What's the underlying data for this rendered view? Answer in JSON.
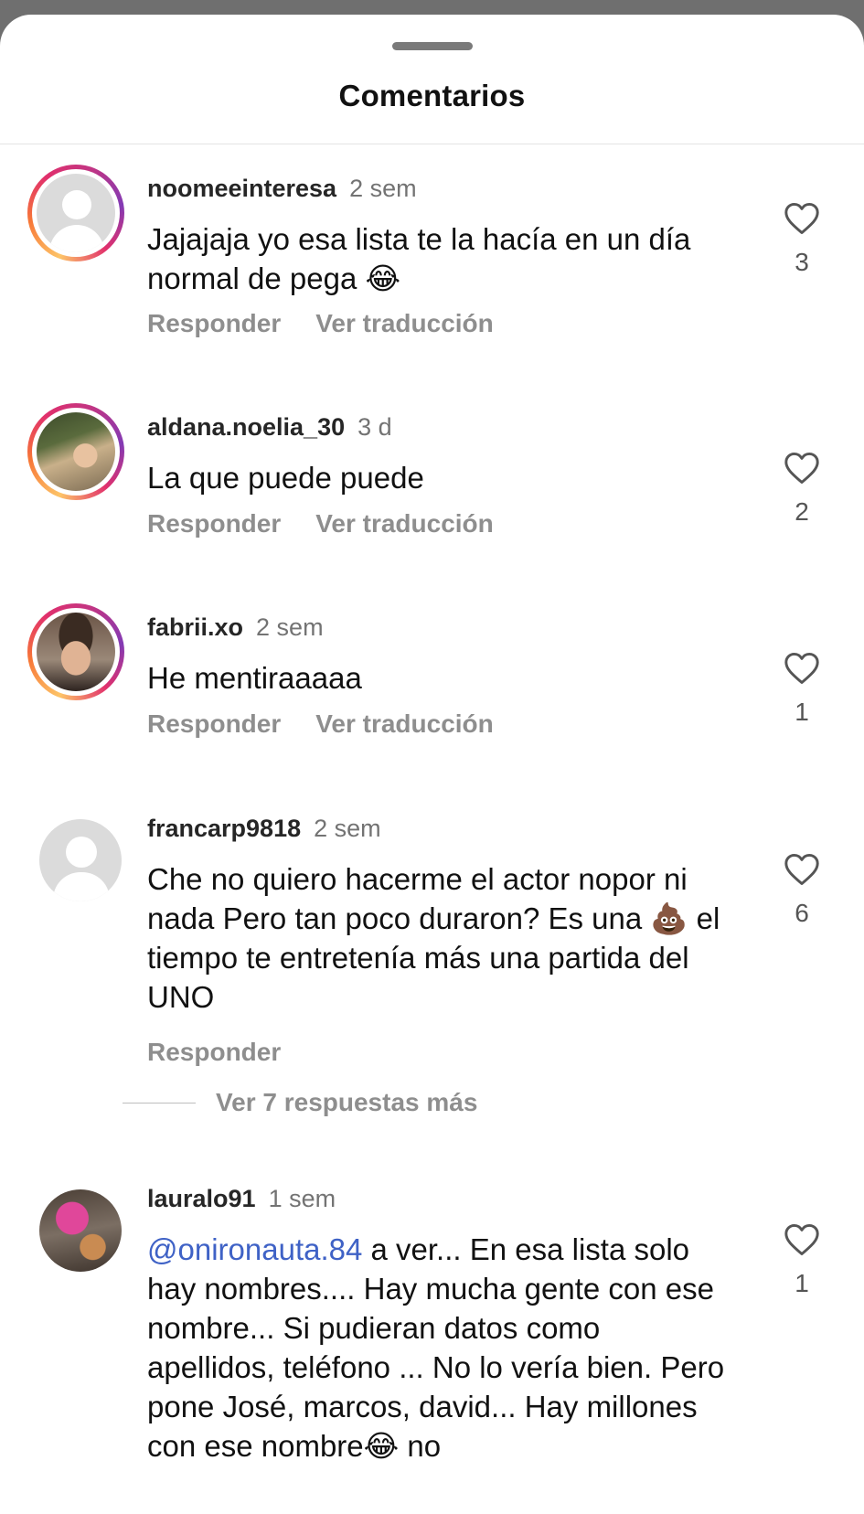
{
  "header": {
    "title": "Comentarios"
  },
  "comments": [
    {
      "username": "noomeeinteresa",
      "time": "2 sem",
      "text": "Jajajaja yo esa lista te la hacía en un día normal de pega 😂",
      "reply_label": "Responder",
      "translate_label": "Ver traducción",
      "likes": "3",
      "avatar": "default-avatar",
      "story_ring": true
    },
    {
      "username": "aldana.noelia_30",
      "time": "3 d",
      "text": "La que puede puede",
      "reply_label": "Responder",
      "translate_label": "Ver traducción",
      "likes": "2",
      "avatar": "photo-avatar",
      "story_ring": true
    },
    {
      "username": "fabrii.xo",
      "time": "2 sem",
      "text": "He mentiraaaaa",
      "reply_label": "Responder",
      "translate_label": "Ver traducción",
      "likes": "1",
      "avatar": "photo-avatar",
      "story_ring": true
    },
    {
      "username": "francarp9818",
      "time": "2 sem",
      "text": "Che no quiero hacerme el actor nopor ni nada Pero tan poco duraron? Es una 💩 el tiempo te entretenía más una partida del UNO",
      "reply_label": "Responder",
      "likes": "6",
      "avatar": "default-avatar",
      "story_ring": false
    },
    {
      "username": "lauralo91",
      "time": "1 sem",
      "mention": "@onironauta.84",
      "text": " a ver... En esa lista solo hay nombres.... Hay mucha gente con ese nombre... Si pudieran datos como apellidos, teléfono ... No lo vería bien. Pero pone José, marcos, david... Hay millones con ese nombre😂 no",
      "likes": "1",
      "avatar": "photo-avatar",
      "story_ring": false
    }
  ],
  "more_replies": "Ver 7 respuestas más",
  "icons": {
    "like": "heart-outline-icon",
    "default_avatar": "person-silhouette-icon"
  },
  "colors": {
    "mention": "#3f62c6",
    "secondary_text": "#8e8e8e",
    "ring_gradient": [
      "#fdc468",
      "#e1306c",
      "#833ab4"
    ]
  }
}
